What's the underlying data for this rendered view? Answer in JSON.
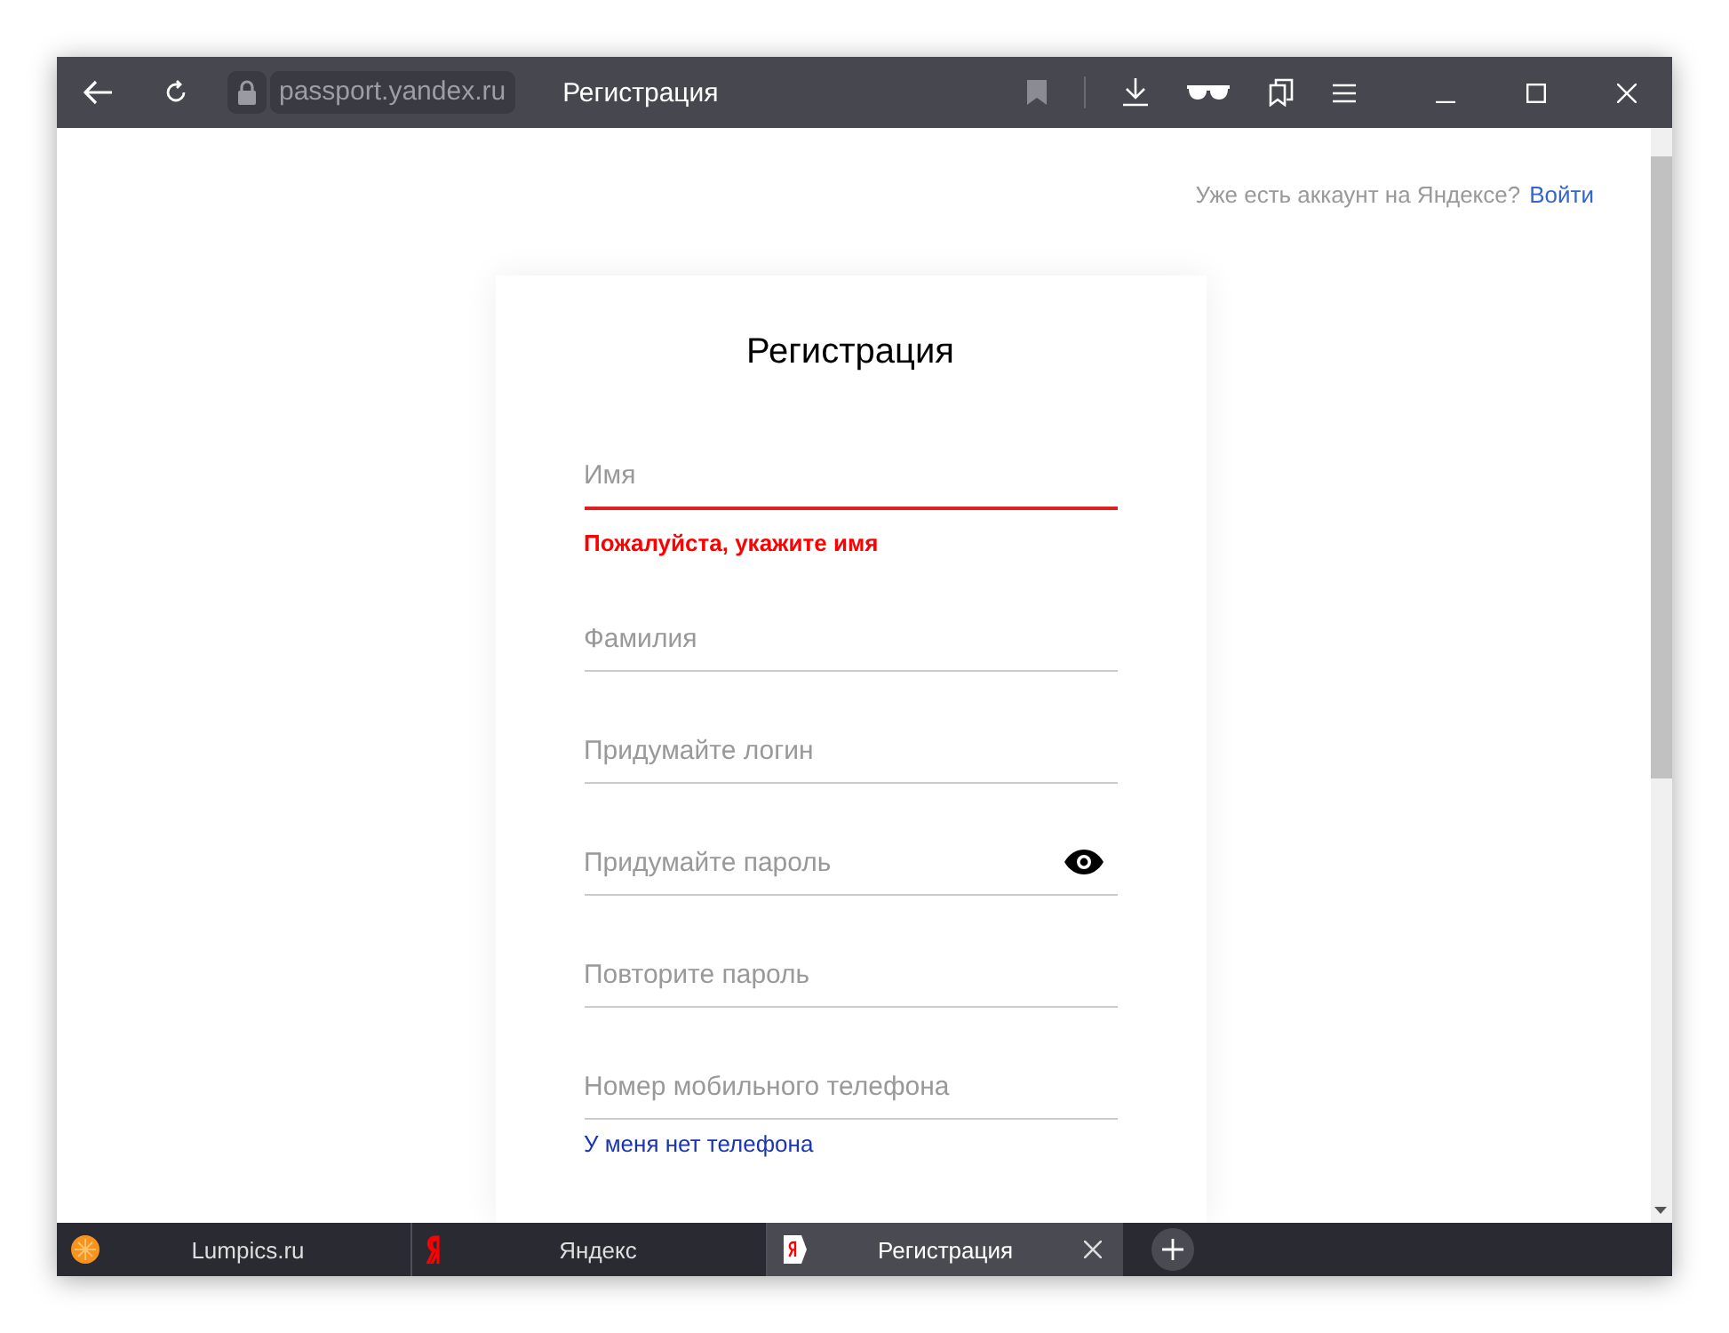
{
  "toolbar": {
    "address": "passport.yandex.ru",
    "page_title": "Регистрация"
  },
  "account_prompt": {
    "text": "Уже есть аккаунт на Яндексе?",
    "link": "Войти"
  },
  "form": {
    "title": "Регистрация",
    "fields": [
      {
        "kind": "text",
        "placeholder": "Имя",
        "invalid": true,
        "error": "Пожалуйста, укажите имя"
      },
      {
        "kind": "text",
        "placeholder": "Фамилия",
        "invalid": false
      },
      {
        "kind": "text",
        "placeholder": "Придумайте логин",
        "invalid": false
      },
      {
        "kind": "password",
        "placeholder": "Придумайте пароль",
        "invalid": false
      },
      {
        "kind": "text",
        "placeholder": "Повторите пароль",
        "invalid": false
      },
      {
        "kind": "text",
        "placeholder": "Номер мобильного телефона",
        "invalid": false,
        "link": "У меня нет телефона"
      }
    ]
  },
  "tabs": [
    {
      "label": "Lumpics.ru",
      "selected": false
    },
    {
      "label": "Яндекс",
      "selected": false
    },
    {
      "label": "Регистрация",
      "selected": true
    }
  ]
}
